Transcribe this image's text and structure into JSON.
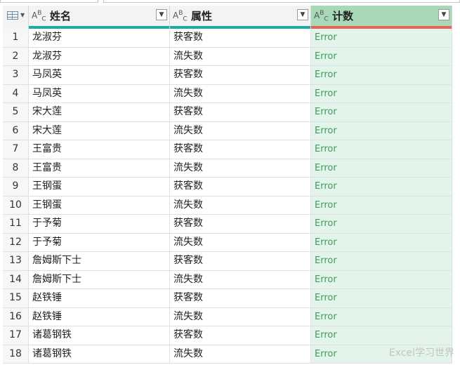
{
  "columns": [
    {
      "type_icon": "ABC",
      "name": "姓名"
    },
    {
      "type_icon": "ABC",
      "name": "属性"
    },
    {
      "type_icon": "ABC",
      "name": "计数"
    }
  ],
  "rows": [
    {
      "n": "1",
      "name": "龙淑芬",
      "attr": "获客数",
      "count": "Error"
    },
    {
      "n": "2",
      "name": "龙淑芬",
      "attr": "流失数",
      "count": "Error"
    },
    {
      "n": "3",
      "name": "马凤英",
      "attr": "获客数",
      "count": "Error"
    },
    {
      "n": "4",
      "name": "马凤英",
      "attr": "流失数",
      "count": "Error"
    },
    {
      "n": "5",
      "name": "宋大莲",
      "attr": "获客数",
      "count": "Error"
    },
    {
      "n": "6",
      "name": "宋大莲",
      "attr": "流失数",
      "count": "Error"
    },
    {
      "n": "7",
      "name": "王富贵",
      "attr": "获客数",
      "count": "Error"
    },
    {
      "n": "8",
      "name": "王富贵",
      "attr": "流失数",
      "count": "Error"
    },
    {
      "n": "9",
      "name": "王钢蛋",
      "attr": "获客数",
      "count": "Error"
    },
    {
      "n": "10",
      "name": "王钢蛋",
      "attr": "流失数",
      "count": "Error"
    },
    {
      "n": "11",
      "name": "于予菊",
      "attr": "获客数",
      "count": "Error"
    },
    {
      "n": "12",
      "name": "于予菊",
      "attr": "流失数",
      "count": "Error"
    },
    {
      "n": "13",
      "name": "詹姆斯下士",
      "attr": "获客数",
      "count": "Error"
    },
    {
      "n": "14",
      "name": "詹姆斯下士",
      "attr": "流失数",
      "count": "Error"
    },
    {
      "n": "15",
      "name": "赵铁锤",
      "attr": "获客数",
      "count": "Error"
    },
    {
      "n": "16",
      "name": "赵铁锤",
      "attr": "流失数",
      "count": "Error"
    },
    {
      "n": "17",
      "name": "诸葛钢铁",
      "attr": "获客数",
      "count": "Error"
    },
    {
      "n": "18",
      "name": "诸葛钢铁",
      "attr": "流失数",
      "count": "Error"
    }
  ],
  "watermark": "Excel学习世界",
  "colors": {
    "quality_ok": "#1eaaa5",
    "quality_error": "#e8625a",
    "selected_column": "#a7d9b8"
  }
}
